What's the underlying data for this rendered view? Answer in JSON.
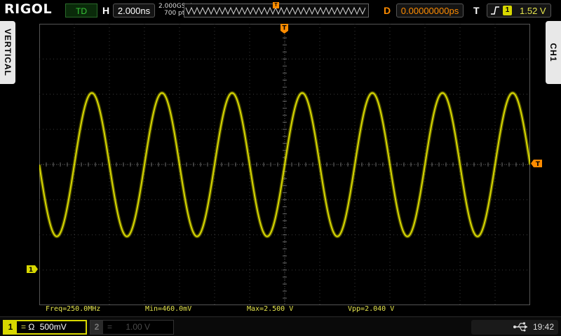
{
  "brand": "RIGOL",
  "top_bar": {
    "mode_status": "TD",
    "horizontal_label": "H",
    "timebase": "2.000ns",
    "sample_rate": "2.000GSa/s",
    "memory_depth": "700 pts",
    "delay_label": "D",
    "delay_value": "0.00000000ps",
    "trigger_label": "T",
    "trigger_source": "1",
    "trigger_level": "1.52 V"
  },
  "side_tabs": {
    "left": "VERTICAL",
    "right": "CH1"
  },
  "markers": {
    "trigger_top": "T",
    "trigger_right": "T",
    "channel1_ground": "1"
  },
  "measurements": {
    "freq": "Freq=250.0MHz",
    "min": "Min=460.0mV",
    "max": "Max=2.500 V",
    "vpp": "Vpp=2.040 V"
  },
  "bottom_bar": {
    "ch1_number": "1",
    "ch1_coupling": "=",
    "ch1_impedance": "Ω",
    "ch1_scale": "500mV",
    "ch2_number": "2",
    "ch2_coupling": "=",
    "ch2_scale": "1.00 V",
    "usb_icon": "usb-icon",
    "clock": "19:42"
  },
  "colors": {
    "ch1": "#d8d800",
    "trigger": "#ff8c00",
    "grid": "#3a3a3a"
  },
  "chart_data": {
    "type": "line",
    "title": "",
    "xlabel": "",
    "ylabel": "",
    "series": [
      {
        "frequency_hz": 250000000,
        "min_v": 0.46,
        "max_v": 2.5
      }
    ],
    "time_per_div_ns": 2.0,
    "volts_per_div": 0.5,
    "h_divisions": 14,
    "v_divisions": 8,
    "grid": true
  }
}
